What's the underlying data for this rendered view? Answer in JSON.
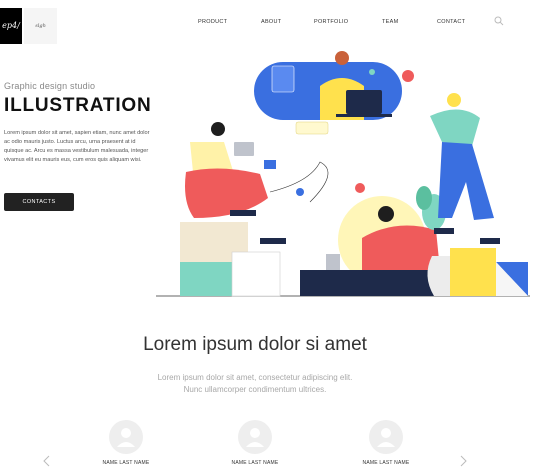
{
  "logo": {
    "text": "ep4/",
    "sub": "slgh"
  },
  "nav": {
    "items": [
      {
        "label": "PRODUCT"
      },
      {
        "label": "ABOUT"
      },
      {
        "label": "PORTFOLIO"
      },
      {
        "label": "TEAM"
      },
      {
        "label": "CONTACT"
      }
    ],
    "search_icon": "search-icon"
  },
  "hero": {
    "subtitle": "Graphic design studio",
    "title": "ILLUSTRATION",
    "paragraph": "Lorem ipsum dolor sit amet, sapien etiam, nunc amet dolor ac odio mauris justo. Luctus arcu, urna praesent at id quisque ac. Arcu es massa vestibulum malesuada, integer vivamus elit eu mauris eus, cum eros quis aliquam wisi.",
    "button_label": "CONTACTS"
  },
  "section": {
    "heading": "Lorem ipsum dolor si amet",
    "lead_line1": "Lorem ipsum dolor sit amet, consectetur adipiscing elit.",
    "lead_line2": "Nunc ullamcorper condimentum ultrices."
  },
  "team": {
    "members": [
      {
        "name": "NAME LAST NAME"
      },
      {
        "name": "NAME LAST NAME"
      },
      {
        "name": "NAME LAST NAME"
      }
    ]
  },
  "colors": {
    "accent_red": "#ef5b5b",
    "accent_blue": "#3a6fe0",
    "accent_teal": "#7fd6c2",
    "accent_yellow": "#ffe14d"
  }
}
